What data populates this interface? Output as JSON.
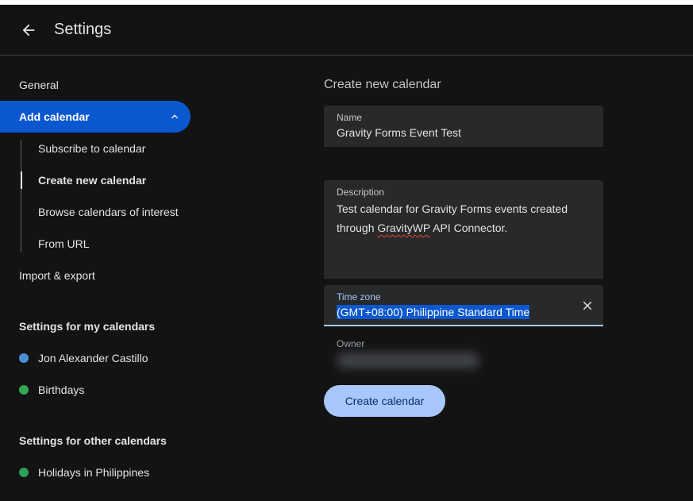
{
  "header": {
    "title": "Settings"
  },
  "sidebar": {
    "general": "General",
    "add_calendar": "Add calendar",
    "sub_items": [
      {
        "label": "Subscribe to calendar"
      },
      {
        "label": "Create new calendar"
      },
      {
        "label": "Browse calendars of interest"
      },
      {
        "label": "From URL"
      }
    ],
    "import_export": "Import & export",
    "my_calendars_heading": "Settings for my calendars",
    "my_calendars": [
      {
        "label": "Jon Alexander Castillo",
        "color": "#4a90d9"
      },
      {
        "label": "Birthdays",
        "color": "#33a852"
      }
    ],
    "other_calendars_heading": "Settings for other calendars",
    "other_calendars": [
      {
        "label": "Holidays in Philippines",
        "color": "#2e9e5b"
      }
    ]
  },
  "form": {
    "title": "Create new calendar",
    "name_label": "Name",
    "name_value": "Gravity Forms Event Test",
    "description_label": "Description",
    "description_line1": "Test calendar for Gravity Forms events created",
    "description_line2_pre": "through ",
    "description_line2_squiggle": "GravityWP",
    "description_line2_post": " API Connector.",
    "timezone_label": "Time zone",
    "timezone_value": "(GMT+08:00) Philippine Standard Time",
    "owner_label": "Owner",
    "create_button": "Create calendar"
  },
  "icons": {
    "back": "arrow-back-icon",
    "collapse": "chevron-up-icon",
    "clear": "close-icon"
  },
  "colors": {
    "accent": "#0b57d0",
    "button": "#a8c7fa",
    "background": "#131314"
  }
}
